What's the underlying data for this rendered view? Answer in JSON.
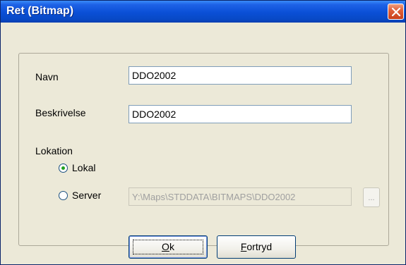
{
  "window": {
    "title": "Ret (Bitmap)"
  },
  "form": {
    "name_label": "Navn",
    "name_value": "DDO2002",
    "description_label": "Beskrivelse",
    "description_value": "DDO2002",
    "location_label": "Lokation",
    "local_label": "Lokal",
    "server_label": "Server",
    "server_path": "Y:\\Maps\\STDDATA\\BITMAPS\\DDO2002",
    "browse_label": "...",
    "selected_location": "Lokal"
  },
  "buttons": {
    "ok_mnemonic": "O",
    "ok_rest": "k",
    "cancel_mnemonic": "F",
    "cancel_rest": "ortryd"
  },
  "colors": {
    "titlebar": "#0a4fd6",
    "dialog_bg": "#ece9d8",
    "close_button": "#e0603a",
    "radio_dot": "#21a121"
  },
  "icons": {
    "close": "close-x-icon"
  }
}
